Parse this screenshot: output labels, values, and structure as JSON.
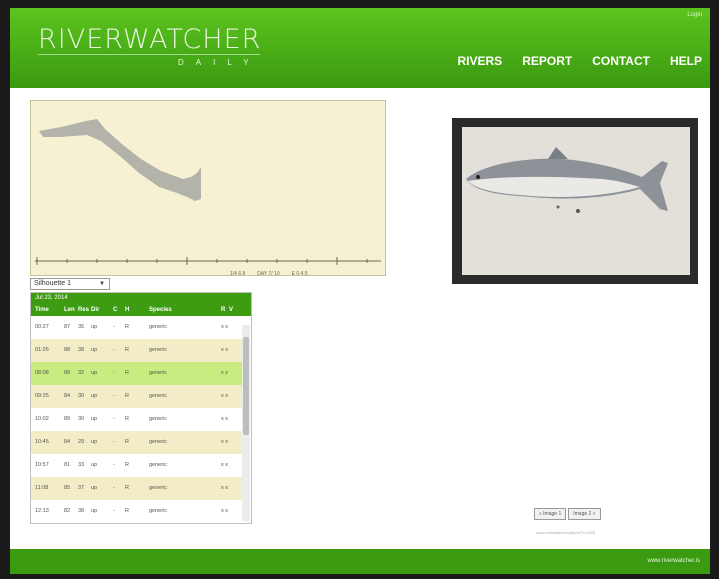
{
  "header": {
    "top_link": "Login",
    "logo": "RIVERWATCHER",
    "logo_sub": "DAILY",
    "nav": [
      "RIVERS",
      "REPORT",
      "CONTACT",
      "HELP"
    ]
  },
  "plot": {
    "footer_labels": [
      "1/4 6 8",
      "DAY 7/ 10",
      "E 0 4 5"
    ]
  },
  "select": {
    "value": "Silhouette 1"
  },
  "table": {
    "date": "Jul 23, 2014",
    "columns": [
      "Time",
      "Len",
      "Res",
      "Dir",
      "C",
      "H",
      "Species",
      "R",
      "V"
    ],
    "rows": [
      [
        "00:27",
        "87",
        "35",
        "up",
        "-",
        "R",
        "generic",
        "x x"
      ],
      [
        "01:26",
        "88",
        "38",
        "up",
        "-",
        "R",
        "generic",
        "x x"
      ],
      [
        "08:08",
        "88",
        "32",
        "up",
        "-",
        "R",
        "generic",
        "x x"
      ],
      [
        "09:25",
        "84",
        "30",
        "up",
        "-",
        "R",
        "generic",
        "x x"
      ],
      [
        "10:02",
        "89",
        "30",
        "up",
        "-",
        "R",
        "generic",
        "x x"
      ],
      [
        "10:45",
        "84",
        "29",
        "up",
        "-",
        "R",
        "generic",
        "x x"
      ],
      [
        "10:57",
        "81",
        "33",
        "up",
        "-",
        "R",
        "generic",
        "x x"
      ],
      [
        "11:08",
        "85",
        "37",
        "up",
        "-",
        "R",
        "generic",
        "x x"
      ],
      [
        "12:13",
        "82",
        "38",
        "up",
        "-",
        "R",
        "generic",
        "x x"
      ]
    ],
    "selected_row": 2
  },
  "buttons": [
    "« Image 1",
    "Image 2 »"
  ],
  "small_text": "www.riverwatcherdaily.is/?r=2005",
  "footer": {
    "text": "www.riverwatcher.is"
  },
  "colors": {
    "green": "#3d9c12",
    "plot_bg": "#f6f1d2",
    "selected_row": "#c9ec80"
  }
}
